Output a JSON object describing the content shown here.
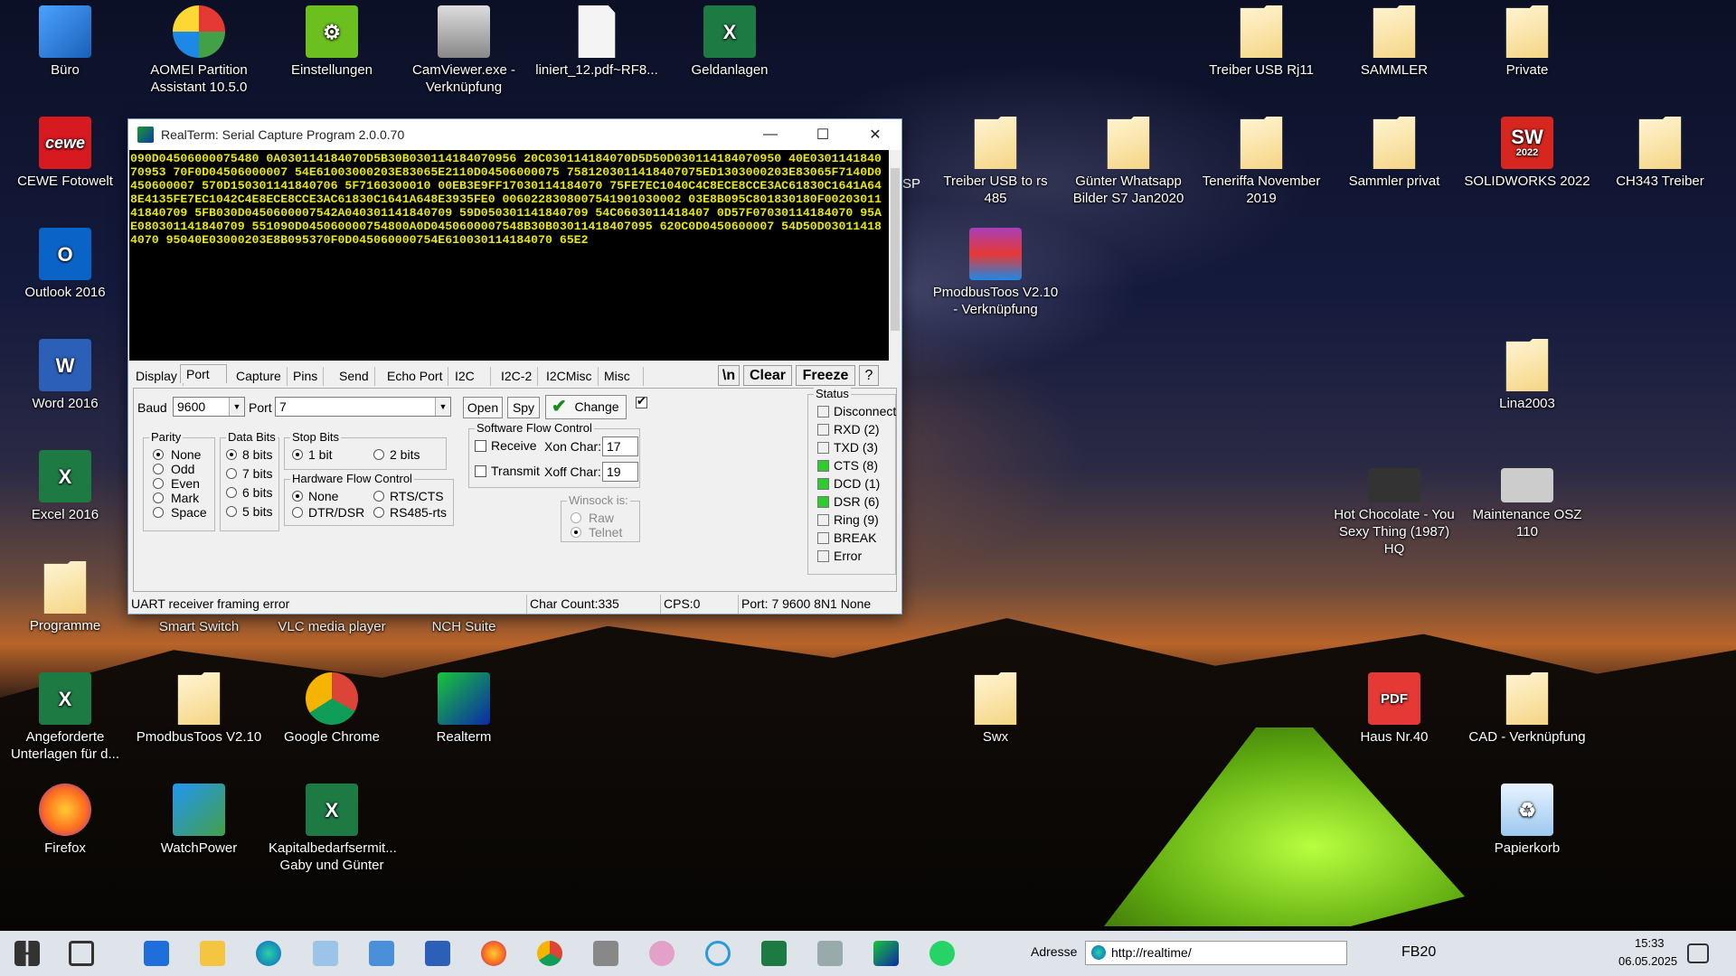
{
  "desktop": {
    "icons": [
      {
        "label": "Büro"
      },
      {
        "label": "AOMEI Partition Assistant 10.5.0"
      },
      {
        "label": "Einstellungen"
      },
      {
        "label": "CamViewer.exe - Verknüpfung"
      },
      {
        "label": "liniert_12.pdf~RF8..."
      },
      {
        "label": "Geldanlagen"
      },
      {
        "label": "Treiber USB Rj11"
      },
      {
        "label": "SAMMLER"
      },
      {
        "label": "Private"
      },
      {
        "label": "CEWE Fotowelt"
      },
      {
        "label": "Treiber USB to rs 485"
      },
      {
        "label": "Günter Whatsapp Bilder S7 Jan2020"
      },
      {
        "label": "Teneriffa November 2019"
      },
      {
        "label": "Sammler privat"
      },
      {
        "label": "SOLIDWORKS 2022"
      },
      {
        "label": "CH343 Treiber"
      },
      {
        "label": "Outlook 2016"
      },
      {
        "label": "PmodbusToos V2.10 - Verknüpfung"
      },
      {
        "label": "Word 2016"
      },
      {
        "label": "Lina2003"
      },
      {
        "label": "Excel 2016"
      },
      {
        "label": "Hot Chocolate - You Sexy Thing (1987) HQ"
      },
      {
        "label": "Maintenance OSZ 110"
      },
      {
        "label": "Programme"
      },
      {
        "label": "Smart Switch"
      },
      {
        "label": "VLC media player"
      },
      {
        "label": "NCH Suite"
      },
      {
        "label": "Angeforderte Unterlagen für d..."
      },
      {
        "label": "PmodbusToos V2.10"
      },
      {
        "label": "Google Chrome"
      },
      {
        "label": "Realterm"
      },
      {
        "label": "Swx"
      },
      {
        "label": "Haus Nr.40"
      },
      {
        "label": "CAD - Verknüpfung"
      },
      {
        "label": "Firefox"
      },
      {
        "label": "WatchPower"
      },
      {
        "label": "Kapitalbedarfsermit... Gaby und Günter"
      },
      {
        "label": "Papierkorb"
      }
    ],
    "cewe_text": "cewe",
    "sw_text": "SW",
    "sw_year": "2022",
    "pdf_text": "PDF",
    "partial_label": "SP"
  },
  "window": {
    "title": "RealTerm: Serial Capture Program 2.0.0.70",
    "minimize": "—",
    "maximize": "☐",
    "close": "✕",
    "terminal_text": "090D04506000075480 0A030114184070D5B30B030114184070956 20C030114184070D5D50D030114184070950 40E030114184070953 70F0D04506000007 54E61003000203E83065E2110D04506000075 7581203011418407075ED1303000203E83065F7140D0450600007 570D150301141840706 5F7160300010 00EB3E9FF17030114184070 75FE7EC1040C4C8ECE8CCE3AC61830C1641A648E4135FE7EC1042C4E8ECE8CCE3AC61830C1641A648E3935FE0 0060228308007541901030002 03E8B095C801830180F0020301141840709 5FB030D0450600007542A040301141840709 59D050301141840709 54C0603011418407 0D57F07030114184070 95AE080301141840709 551090D045060000754800A0D0450600007548B30B03011418407095 620C0D0450600007 54D50D030114184070 95040E03000203E8B095370F0D045060000754E610030114184070 65E2",
    "tabs": {
      "display": "Display",
      "port": "Port",
      "capture": "Capture",
      "pins": "Pins",
      "send": "Send",
      "echo_port": "Echo Port",
      "i2c": "I2C",
      "i2c2": "I2C-2",
      "i2cmisc": "I2CMisc",
      "misc": "Misc"
    },
    "toolbar": {
      "newline": "\\n",
      "clear": "Clear",
      "freeze": "Freeze",
      "help": "?"
    },
    "port": {
      "baud_label": "Baud",
      "baud_value": "9600",
      "port_label": "Port",
      "port_value": "7",
      "open": "Open",
      "spy": "Spy",
      "change": "Change",
      "parity_title": "Parity",
      "parity": [
        "None",
        "Odd",
        "Even",
        "Mark",
        "Space"
      ],
      "databits_title": "Data Bits",
      "databits": [
        "8 bits",
        "7 bits",
        "6 bits",
        "5 bits"
      ],
      "stopbits_title": "Stop Bits",
      "stop_1": "1 bit",
      "stop_2": "2 bits",
      "hwflow_title": "Hardware Flow Control",
      "hw_none": "None",
      "hw_rtscts": "RTS/CTS",
      "hw_dtrdsr": "DTR/DSR",
      "hw_rs485": "RS485-rts",
      "swflow_title": "Software Flow Control",
      "receive": "Receive",
      "transmit": "Transmit",
      "xon_label": "Xon Char:",
      "xon_value": "17",
      "xoff_label": "Xoff Char:",
      "xoff_value": "19",
      "winsock_title": "Winsock is:",
      "raw": "Raw",
      "telnet": "Telnet"
    },
    "status": {
      "title": "Status",
      "items": [
        {
          "label": "Disconnect",
          "on": false
        },
        {
          "label": "RXD (2)",
          "on": false
        },
        {
          "label": "TXD (3)",
          "on": false
        },
        {
          "label": "CTS (8)",
          "on": true
        },
        {
          "label": "DCD (1)",
          "on": true
        },
        {
          "label": "DSR (6)",
          "on": true
        },
        {
          "label": "Ring (9)",
          "on": false
        },
        {
          "label": "BREAK",
          "on": false
        },
        {
          "label": "Error",
          "on": false
        }
      ],
      "led_on_color": "#2ecc2e"
    },
    "statusbar": {
      "message": "UART receiver framing error",
      "char_count": "Char Count:335",
      "cps": "CPS:0",
      "port_info": "Port: 7 9600 8N1 None"
    }
  },
  "taskbar": {
    "address_label": "Adresse",
    "address_value": "http://realtime/",
    "network": "FB20",
    "time": "15:33",
    "date": "06.05.2025"
  }
}
